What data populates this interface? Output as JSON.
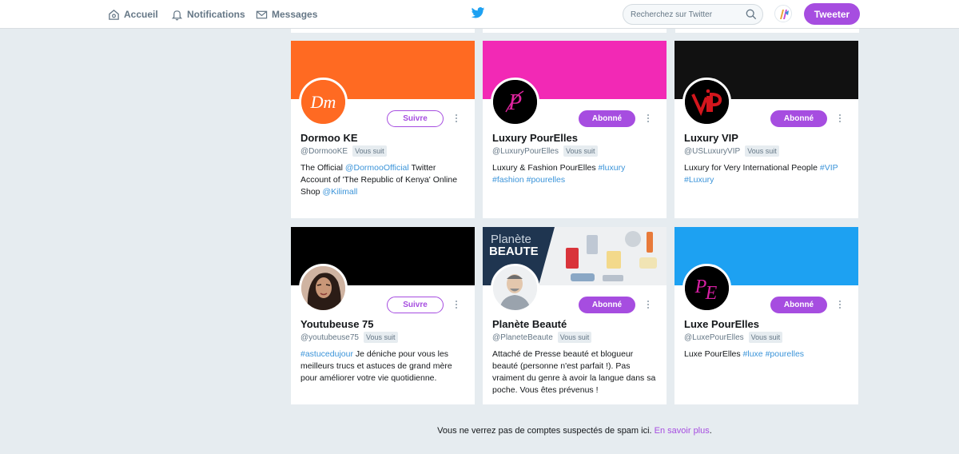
{
  "nav": {
    "home": "Accueil",
    "notifications": "Notifications",
    "messages": "Messages"
  },
  "search": {
    "placeholder": "Recherchez sur Twitter"
  },
  "tweet_button": "Tweeter",
  "colors": {
    "accent": "#a64de0",
    "link": "#3b94d9",
    "background": "#e6ecf0"
  },
  "cards": [
    {
      "name": "Dormoo KE",
      "handle": "@DormooKE",
      "badge": "Vous suit",
      "action": "Suivre",
      "action_state": "follow",
      "banner_color": "#ff6a22",
      "avatar_icon": "dormoo-logo-icon",
      "bio": [
        {
          "t": "The Official "
        },
        {
          "t": "@DormooOfficial",
          "link": true
        },
        {
          "t": " Twitter Account of 'The Republic of Kenya' Online Shop "
        },
        {
          "t": "@Kilimall",
          "link": true
        }
      ]
    },
    {
      "name": "Luxury PourElles",
      "handle": "@LuxuryPourElles",
      "badge": "Vous suit",
      "action": "Abonné",
      "action_state": "following",
      "banner_color": "#f229b5",
      "avatar_icon": "luxury-pourelles-logo-icon",
      "bio": [
        {
          "t": "Luxury & Fashion PourElles "
        },
        {
          "t": "#luxury",
          "link": true
        },
        {
          "t": " "
        },
        {
          "t": "#fashion",
          "link": true
        },
        {
          "t": " "
        },
        {
          "t": "#pourelles",
          "link": true
        }
      ]
    },
    {
      "name": "Luxury VIP",
      "handle": "@USLuxuryVIP",
      "badge": "Vous suit",
      "action": "Abonné",
      "action_state": "following",
      "banner_color": "#111111",
      "avatar_icon": "luxury-vip-logo-icon",
      "bio": [
        {
          "t": "Luxury for Very International People "
        },
        {
          "t": "#VIP",
          "link": true
        },
        {
          "t": " "
        },
        {
          "t": "#Luxury",
          "link": true
        }
      ]
    },
    {
      "name": "Youtubeuse 75",
      "handle": "@youtubeuse75",
      "badge": "Vous suit",
      "action": "Suivre",
      "action_state": "follow",
      "banner_color": "#000000",
      "avatar_icon": "person-photo-icon",
      "bio": [
        {
          "t": "#astucedujour",
          "link": true
        },
        {
          "t": " Je déniche pour vous les meilleurs trucs et astuces de grand mère pour améliorer votre vie quotidienne."
        }
      ]
    },
    {
      "name": "Planète Beauté",
      "handle": "@PlaneteBeaute",
      "badge": "Vous suit",
      "action": "Abonné",
      "action_state": "following",
      "banner_color": "#1f3550",
      "banner_text": [
        "Planète",
        "BEAUTE"
      ],
      "avatar_icon": "man-illustration-icon",
      "bio": [
        {
          "t": "Attaché de Presse beauté et blogueur beauté (personne n'est parfait !). Pas vraiment du genre à avoir la langue dans sa poche. Vous êtes prévenus !"
        }
      ]
    },
    {
      "name": "Luxe PourElles",
      "handle": "@LuxePourElles",
      "badge": "Vous suit",
      "action": "Abonné",
      "action_state": "following",
      "banner_color": "#1da1f2",
      "avatar_icon": "luxe-pourelles-logo-icon",
      "bio": [
        {
          "t": "Luxe PourElles "
        },
        {
          "t": "#luxe",
          "link": true
        },
        {
          "t": " "
        },
        {
          "t": "#pourelles",
          "link": true
        }
      ]
    }
  ],
  "footer": {
    "text": "Vous ne verrez pas de comptes suspectés de spam ici. ",
    "link": "En savoir plus",
    "end": "."
  }
}
